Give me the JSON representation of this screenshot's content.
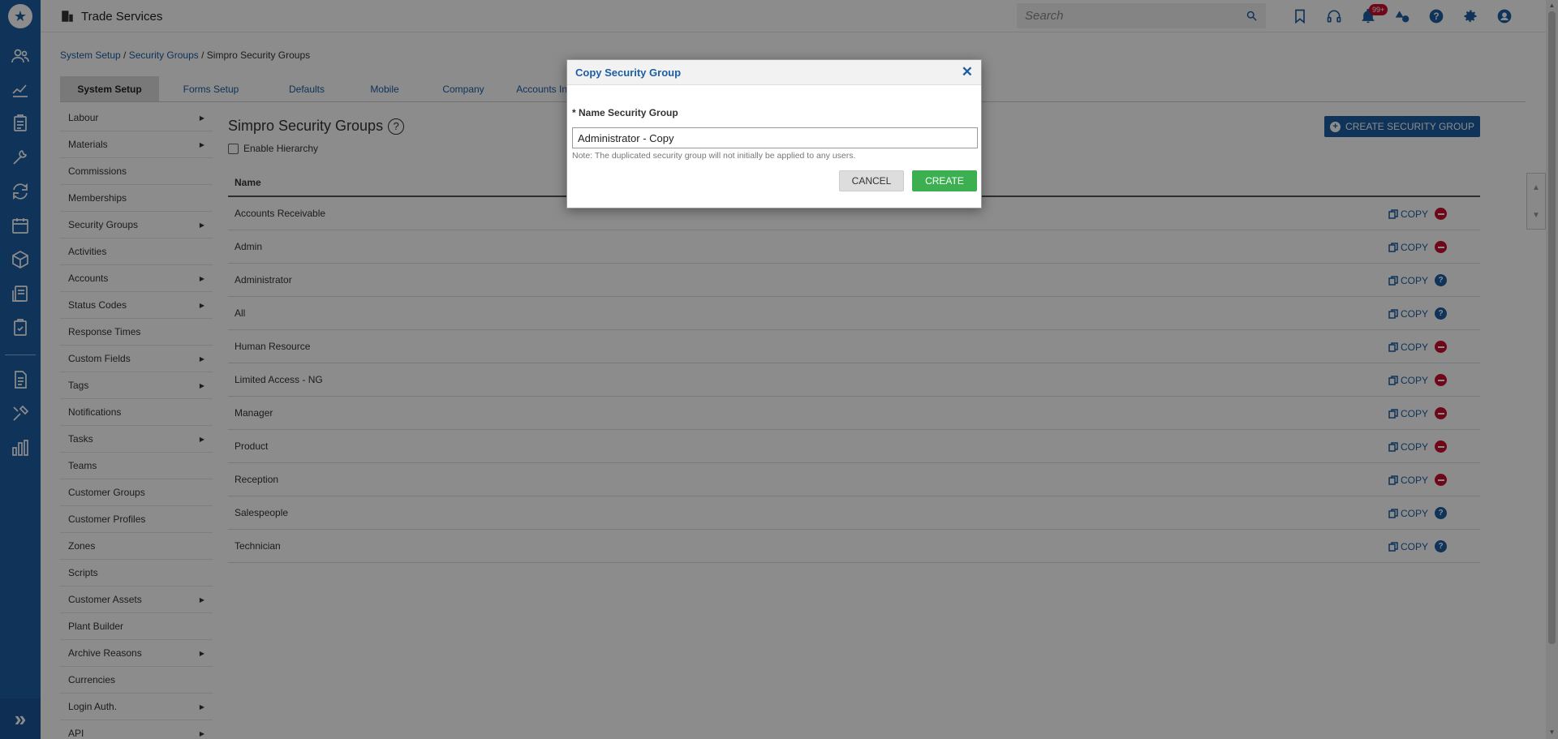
{
  "app": {
    "title": "Trade Services",
    "search_placeholder": "Search",
    "notification_count": "99+"
  },
  "breadcrumb": {
    "item1": "System Setup",
    "sep1": " / ",
    "item2": "Security Groups",
    "sep2": " / ",
    "current": "Simpro Security Groups"
  },
  "tabs": [
    "System Setup",
    "Forms Setup",
    "Defaults",
    "Mobile",
    "Company",
    "Accounts Integration"
  ],
  "subnav": [
    {
      "label": "Labour",
      "arrow": true
    },
    {
      "label": "Materials",
      "arrow": true
    },
    {
      "label": "Commissions",
      "arrow": false
    },
    {
      "label": "Memberships",
      "arrow": false
    },
    {
      "label": "Security Groups",
      "arrow": true
    },
    {
      "label": "Activities",
      "arrow": false
    },
    {
      "label": "Accounts",
      "arrow": true
    },
    {
      "label": "Status Codes",
      "arrow": true
    },
    {
      "label": "Response Times",
      "arrow": false
    },
    {
      "label": "Custom Fields",
      "arrow": true
    },
    {
      "label": "Tags",
      "arrow": true
    },
    {
      "label": "Notifications",
      "arrow": false
    },
    {
      "label": "Tasks",
      "arrow": true
    },
    {
      "label": "Teams",
      "arrow": false
    },
    {
      "label": "Customer Groups",
      "arrow": false
    },
    {
      "label": "Customer Profiles",
      "arrow": false
    },
    {
      "label": "Zones",
      "arrow": false
    },
    {
      "label": "Scripts",
      "arrow": false
    },
    {
      "label": "Customer Assets",
      "arrow": true
    },
    {
      "label": "Plant Builder",
      "arrow": false
    },
    {
      "label": "Archive Reasons",
      "arrow": true
    },
    {
      "label": "Currencies",
      "arrow": false
    },
    {
      "label": "Login Auth.",
      "arrow": true
    },
    {
      "label": "API",
      "arrow": true
    }
  ],
  "content": {
    "title": "Simpro Security Groups",
    "help_glyph": "?",
    "enable_hierarchy_label": "Enable Hierarchy",
    "create_button_label": "CREATE SECURITY GROUP",
    "column_name": "Name",
    "copy_label": "COPY",
    "rows": [
      {
        "name": "Accounts Receivable",
        "action": "delete"
      },
      {
        "name": "Admin",
        "action": "delete"
      },
      {
        "name": "Administrator",
        "action": "help"
      },
      {
        "name": "All",
        "action": "help"
      },
      {
        "name": "Human Resource",
        "action": "delete"
      },
      {
        "name": "Limited Access - NG",
        "action": "delete"
      },
      {
        "name": "Manager",
        "action": "delete"
      },
      {
        "name": "Product",
        "action": "delete"
      },
      {
        "name": "Reception",
        "action": "delete"
      },
      {
        "name": "Salespeople",
        "action": "help"
      },
      {
        "name": "Technician",
        "action": "help"
      }
    ]
  },
  "modal": {
    "title": "Copy Security Group",
    "close_glyph": "✕",
    "field_label": "* Name Security Group",
    "field_value": "Administrator - Copy",
    "note": "Note: The duplicated security group will not initially be applied to any users.",
    "cancel_label": "CANCEL",
    "create_label": "CREATE"
  },
  "colors": {
    "brand": "#1d5ea3",
    "create": "#3caf50",
    "delete": "#c8102e"
  }
}
